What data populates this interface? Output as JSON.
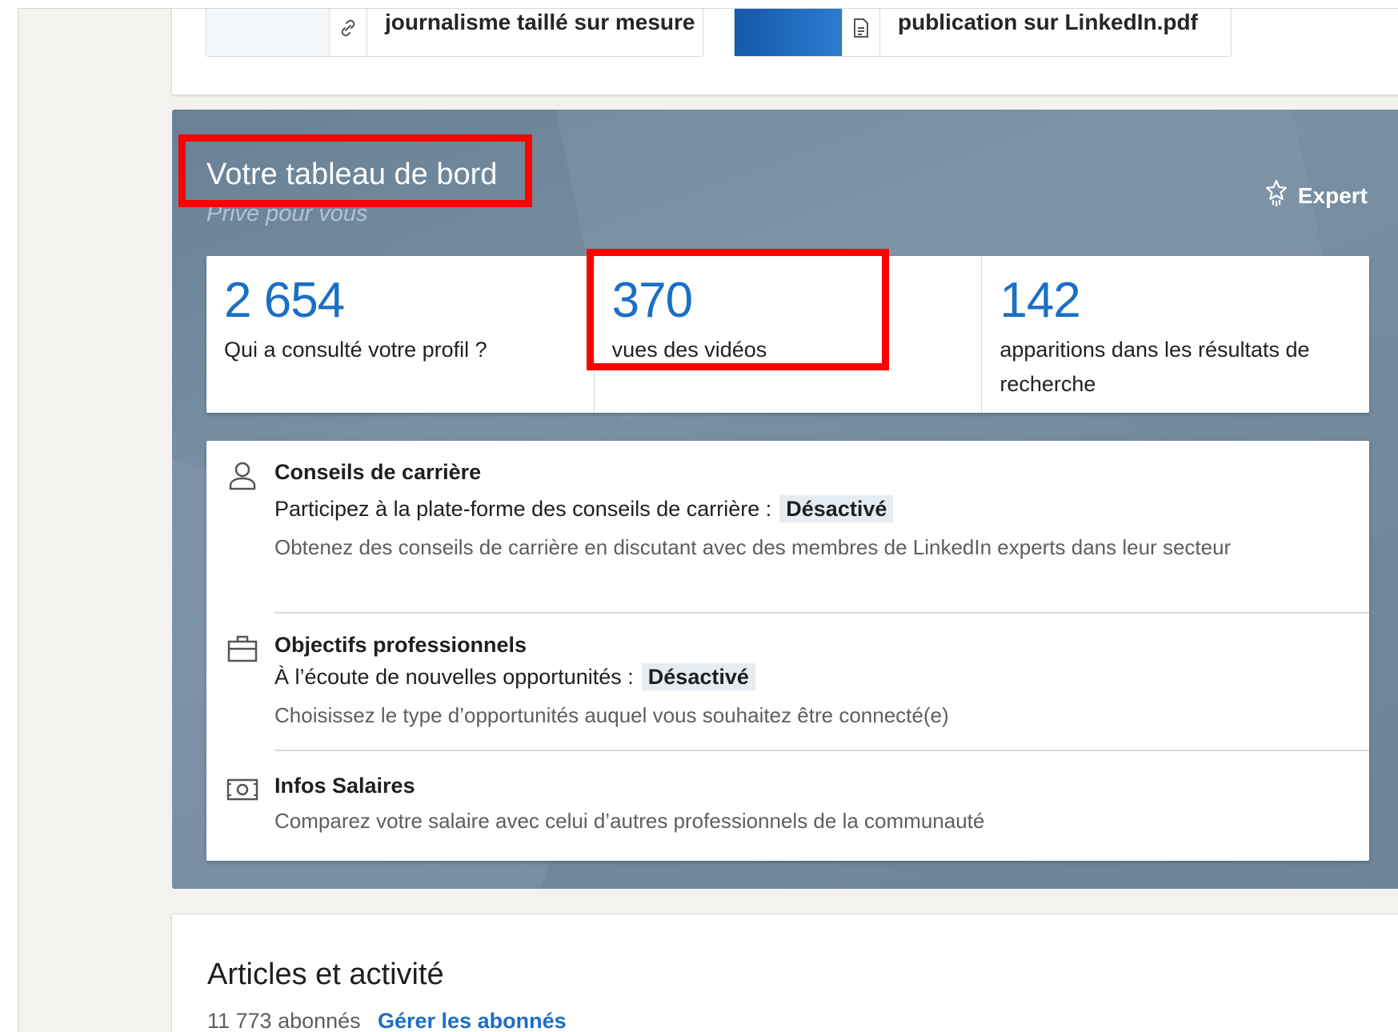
{
  "documents": [
    {
      "title": "journalisme taillé sur mesure",
      "icon": "link-icon"
    },
    {
      "title": "publication sur LinkedIn.pdf",
      "icon": "document-icon"
    }
  ],
  "dashboard": {
    "title": "Votre tableau de bord",
    "subtitle": "Privé pour vous",
    "expert_label": "Expert",
    "stats": [
      {
        "value": "2 654",
        "label": "Qui a consulté votre profil ?"
      },
      {
        "value": "370",
        "label": "vues des vidéos"
      },
      {
        "value": "142",
        "label": "apparitions dans les résultats de recherche"
      }
    ],
    "features": [
      {
        "icon": "person-icon",
        "title": "Conseils de carrière",
        "line": "Participez à la plate-forme des conseils de carrière :",
        "status": "Désactivé",
        "description": "Obtenez des conseils de carrière en discutant avec des membres de LinkedIn experts dans leur secteur"
      },
      {
        "icon": "briefcase-icon",
        "title": "Objectifs professionnels",
        "line": "À l’écoute de nouvelles opportunités :",
        "status": "Désactivé",
        "description": "Choisissez le type d’opportunités auquel vous souhaitez être connecté(e)"
      },
      {
        "icon": "money-icon",
        "title": "Infos Salaires",
        "description": "Comparez votre salaire avec celui d’autres professionnels de la communauté"
      }
    ]
  },
  "articles": {
    "title": "Articles et activité",
    "followers": "11 773 abonnés",
    "manage_label": "Gérer les abonnés"
  },
  "colors": {
    "accent": "#1a6fc6",
    "dashboard_bg": "#7990a3",
    "highlight": "#ff0000"
  }
}
